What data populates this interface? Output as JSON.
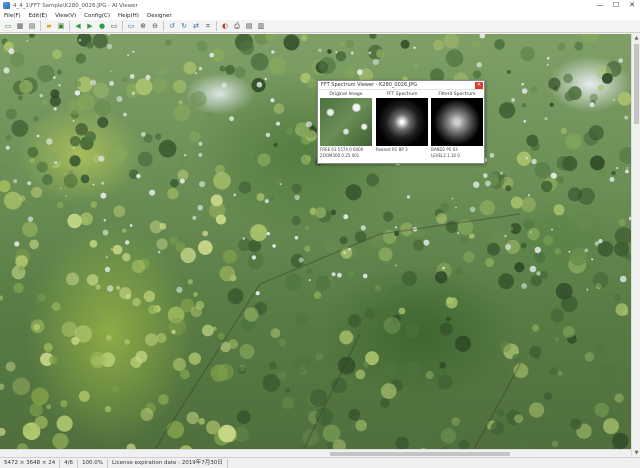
{
  "window": {
    "title": "4_4_1\\FFT Sample\\K280_0026.JPG - AI Viewer",
    "minimize_glyph": "—",
    "maximize_glyph": "☐",
    "close_glyph": "✕"
  },
  "menu": {
    "items": [
      "File(F)",
      "Edit(E)",
      "View(V)",
      "Config(C)",
      "Help(H)",
      "Designer"
    ]
  },
  "toolbar": {
    "buttons": [
      {
        "icon": "open-folder-icon",
        "glyph": "▭",
        "color": "#3a8a3a"
      },
      {
        "icon": "thumbnail-icon",
        "glyph": "▦",
        "color": "#555555"
      },
      {
        "icon": "grid-icon",
        "glyph": "▤",
        "color": "#555555"
      },
      {
        "icon": "folder-icon",
        "glyph": "▰",
        "color": "#d9a227"
      },
      {
        "icon": "save-icon",
        "glyph": "▣",
        "color": "#2f7f2f"
      },
      {
        "icon": "prev-icon",
        "glyph": "◀",
        "color": "#2f9e3a"
      },
      {
        "icon": "next-icon",
        "glyph": "▶",
        "color": "#2f9e3a"
      },
      {
        "icon": "play-icon",
        "glyph": "●",
        "color": "#2f9e3a"
      },
      {
        "icon": "fit-window-icon",
        "glyph": "▭",
        "color": "#4a4a4a"
      },
      {
        "icon": "actual-size-icon",
        "glyph": "▭",
        "color": "#2d6fb8"
      },
      {
        "icon": "zoom-in-icon",
        "glyph": "⊕",
        "color": "#444444"
      },
      {
        "icon": "zoom-out-icon",
        "glyph": "⊖",
        "color": "#444444"
      },
      {
        "icon": "rotate-left-icon",
        "glyph": "↺",
        "color": "#2d6fb8"
      },
      {
        "icon": "rotate-right-icon",
        "glyph": "↻",
        "color": "#2d6fb8"
      },
      {
        "icon": "flip-icon",
        "glyph": "⇄",
        "color": "#2d6fb8"
      },
      {
        "icon": "crop-icon",
        "glyph": "⌗",
        "color": "#444444"
      },
      {
        "icon": "color-icon",
        "glyph": "◐",
        "color": "#c0392b"
      },
      {
        "icon": "print-icon",
        "glyph": "⎙",
        "color": "#444444"
      },
      {
        "icon": "settings-icon",
        "glyph": "▤",
        "color": "#444444"
      },
      {
        "icon": "info-icon",
        "glyph": "▥",
        "color": "#444444"
      }
    ]
  },
  "fft_window": {
    "title": "FFT Spectrum Viewer - K280_0026.JPG",
    "close_glyph": "✕",
    "panels": [
      {
        "label": "Original Image",
        "info": [
          "FREE 01 5574 0  6000",
          "ZOOM300 0.25 001"
        ]
      },
      {
        "label": "FFT Spectrum",
        "info": [
          "Realest  RC BP 3"
        ]
      },
      {
        "label": "Filterd Spectrum",
        "info": [
          "BAND2  PS 03",
          "LEVEL2  1.16 0"
        ]
      }
    ]
  },
  "statusbar": {
    "cells": [
      "5472 × 3648 × 24",
      "4/6",
      "100.0%",
      "License expiration date : 2019年7月30日"
    ]
  }
}
